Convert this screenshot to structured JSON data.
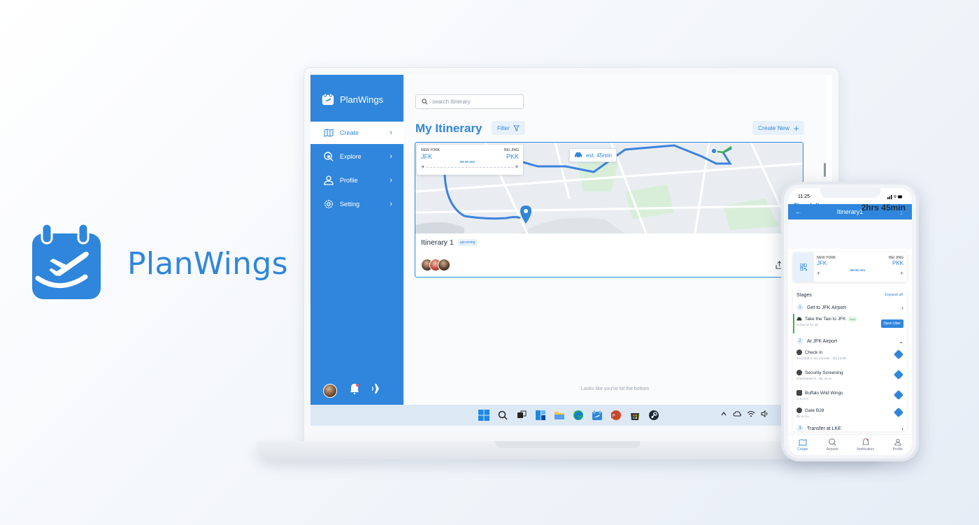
{
  "brand": {
    "name": "PlanWings"
  },
  "colors": {
    "primary": "#2f86dc",
    "route": "#3d82dd",
    "green": "#3cb34a",
    "taskbar": "#dde8f5"
  },
  "desktop": {
    "sidebar": {
      "logo_text": "PlanWings",
      "items": [
        {
          "label": "Create",
          "icon": "map-icon",
          "active": true
        },
        {
          "label": "Explore",
          "icon": "explore-icon"
        },
        {
          "label": "Profile",
          "icon": "user-icon"
        },
        {
          "label": "Setting",
          "icon": "gear-icon"
        }
      ],
      "bottom_icons": [
        "avatar",
        "bell-icon",
        "plane-icon"
      ]
    },
    "search": {
      "placeholder": "search itinerary"
    },
    "page_title": "My Itinerary",
    "filter_label": "Filter",
    "create_label": "Create New",
    "card": {
      "flight": {
        "from_city": "NEW YORK",
        "from_code": "JFK",
        "to_city": "BEI JING",
        "to_code": "PKK",
        "duration": "6H 50 min"
      },
      "eta": "est. 45min",
      "title": "Itinerary 1",
      "status": "upcoming"
    },
    "bottom_note": "Looks like you've hit the bottom",
    "taskbar_icons": [
      "windows-icon",
      "search-icon",
      "taskview-icon",
      "widgets-icon",
      "explorer-icon",
      "edge-icon",
      "planwings-icon",
      "powerpoint-icon",
      "store-icon",
      "steam-icon"
    ],
    "tray_icons": [
      "chevron-up-icon",
      "cloud-icon",
      "wifi-icon",
      "volume-icon"
    ]
  },
  "phone": {
    "time": "11:25",
    "header_title": "Itinerary1",
    "time_left_label": "Time left",
    "time_left_sub": "Boarding gate close in",
    "time_left_value": "2hrs 45min",
    "flight": {
      "from_city": "NEW YORK",
      "from_code": "JFK",
      "to_city": "BEI JING",
      "to_code": "PKK",
      "duration": "6H 50 min"
    },
    "stages_label": "Stages",
    "expand_label": "Expand all",
    "groups": [
      {
        "num": "1",
        "label": "Get to JFK Airport"
      },
      {
        "num": "2",
        "label": "At JFK Airport"
      },
      {
        "num": "3",
        "label": "Transfer at LKE"
      }
    ],
    "taxi": {
      "label": "Take the Taxi to JFK",
      "tag": "Now",
      "sub": "Arrive at 11:45",
      "button": "Open Uber"
    },
    "airport_items": [
      {
        "label": "Check in",
        "sub": "Terminal 4 xxx counter · By 15:00",
        "icon": "check-icon"
      },
      {
        "label": "Security Screening",
        "sub": "Checkpoint 3 · By xx:xx",
        "icon": "security-icon"
      },
      {
        "label": "Buffalo Wild Wings",
        "sub": "A.X.X.X",
        "icon": "food-icon"
      },
      {
        "label": "Gate B28",
        "sub": "By xx:xx",
        "icon": "gate-icon"
      }
    ],
    "nav": [
      {
        "label": "Create",
        "active": true
      },
      {
        "label": "Airports"
      },
      {
        "label": "Notification"
      },
      {
        "label": "Profile"
      }
    ]
  }
}
